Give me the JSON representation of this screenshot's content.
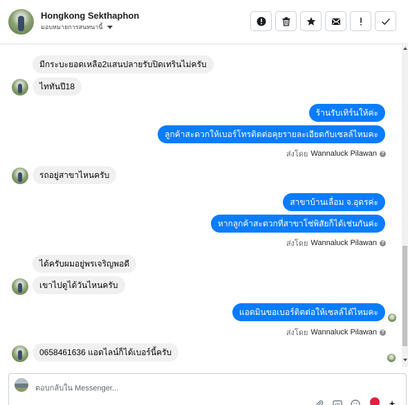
{
  "header": {
    "contact_name": "Hongkong Sekthaphon",
    "assign_label": "มอบหมายการสนทนานี้"
  },
  "toolbar": {
    "buttons": [
      "report-icon",
      "trash-icon",
      "star-icon",
      "mark-unread-icon",
      "important-icon",
      "done-icon"
    ]
  },
  "messages": [
    {
      "dir": "in",
      "text": "มีกระบะยอดเหลือ2แสนปลายรับปิดเทรินไม่ครับ"
    },
    {
      "dir": "in",
      "text": "ไททันปี18"
    },
    {
      "dir": "out",
      "text": "ร้านรับเทิร์นให้ค่ะ"
    },
    {
      "dir": "out",
      "text": "ลูกค้าสะดวกให้เบอร์โทรติดต่อคุยรายละเอียดกับเซลล์ไหมคะ"
    },
    {
      "dir": "in",
      "text": "รถอยู่สาขาไหนครับ"
    },
    {
      "dir": "out",
      "text": "สาขาบ้านเลื่อม จ.อุดรค่ะ"
    },
    {
      "dir": "out",
      "text": "หากลูกค้าสะดวกที่สาขาโซ่พิสัยก็ได้เช่นกันค่ะ"
    },
    {
      "dir": "in",
      "text": "ได้ครับผมอยู่พรเจริญพอดี"
    },
    {
      "dir": "in",
      "text": "เขาไปดูได้วันไหนครับ"
    },
    {
      "dir": "out",
      "text": "แอดมินขอเบอร์ติดต่อให้เซลล์ได้ไหมคะ"
    },
    {
      "dir": "in",
      "text": "0658461636 แอดไลน์ก็ได้เบอร์นี้ครับ"
    }
  ],
  "sent_by": {
    "prefix": "ส่งโดย",
    "agent": "Wannaluck Pilawan"
  },
  "composer": {
    "placeholder": "ตอบกลับใน Messenger..."
  },
  "colors": {
    "outgoing_bubble": "#0a7cff",
    "incoming_bubble": "#f0f0f0",
    "accent_red": "#e41e3f"
  }
}
